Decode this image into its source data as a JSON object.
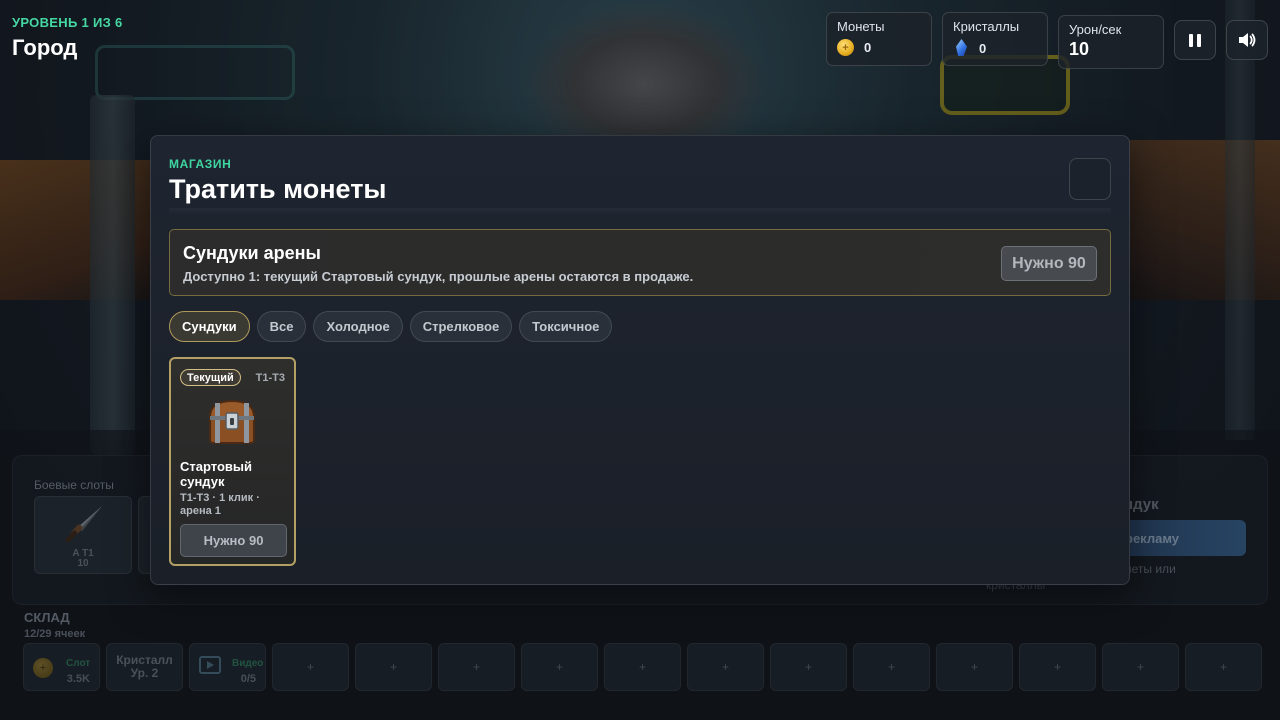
{
  "hud": {
    "level_label": "УРОВЕНЬ 1 ИЗ 6",
    "location": "Город",
    "coins": {
      "label": "Монеты",
      "value": "0",
      "icon": "coin-icon"
    },
    "crystals": {
      "label": "Кристаллы",
      "value": "0",
      "icon": "crystal-icon"
    },
    "dps": {
      "label": "Урон/сек",
      "value": "10"
    },
    "pause_icon": "pause-icon",
    "sound_icon": "speaker-icon"
  },
  "shop": {
    "kicker": "МАГАЗИН",
    "title": "Тратить монеты",
    "arena_card": {
      "title": "Сундуки арены",
      "description": "Доступно 1: текущий Стартовый сундук, прошлые арены остаются в продаже.",
      "button": "Нужно 90"
    },
    "tabs": [
      {
        "label": "Сундуки",
        "active": true
      },
      {
        "label": "Все",
        "active": false
      },
      {
        "label": "Холодное",
        "active": false
      },
      {
        "label": "Стрелковое",
        "active": false
      },
      {
        "label": "Токсичное",
        "active": false
      }
    ],
    "items": [
      {
        "badge": "Текущий",
        "tier": "T1-T3",
        "name": "Стартовый сундук",
        "meta": "T1-T3 · 1 клик · арена 1",
        "button": "Нужно 90",
        "icon": "chest-icon"
      }
    ]
  },
  "background_ui": {
    "combat_slots_title": "Боевые слоты",
    "slot_1": {
      "name": "A T1",
      "value": "10",
      "icon": "knife-icon"
    },
    "chest_panel_title_partial": "ндук",
    "ad_button_partial": "рекламу",
    "side_note_partial": "неты или",
    "side_note2_partial": "кристаллы",
    "storage": {
      "title": "СКЛАД",
      "count": "12/29 ячеек",
      "cells": [
        {
          "type": "coin",
          "label": "Слот",
          "sub": "3.5K"
        },
        {
          "type": "crystal",
          "line1": "Кристалл",
          "line2": "Ур. 2"
        },
        {
          "type": "video",
          "label": "Видео",
          "sub": "0/5"
        },
        {
          "type": "empty",
          "symbol": "+"
        },
        {
          "type": "empty",
          "symbol": "+"
        },
        {
          "type": "empty",
          "symbol": "+"
        },
        {
          "type": "empty",
          "symbol": "+"
        },
        {
          "type": "empty",
          "symbol": "+"
        },
        {
          "type": "empty",
          "symbol": "+"
        },
        {
          "type": "empty",
          "symbol": "+"
        },
        {
          "type": "empty",
          "symbol": "+"
        },
        {
          "type": "empty",
          "symbol": "+"
        },
        {
          "type": "empty",
          "symbol": "+"
        },
        {
          "type": "empty",
          "symbol": "+"
        },
        {
          "type": "empty",
          "symbol": "+"
        }
      ]
    }
  },
  "colors": {
    "accent_green": "#3ed6a0",
    "gold_border": "#b4a065",
    "panel_bg": "#1f2530"
  }
}
